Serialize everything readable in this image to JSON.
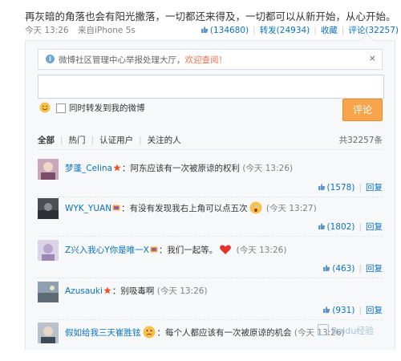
{
  "post": {
    "text": "再灰暗的角落也会有阳光撒落，一切都还来得及，一切都可以从新开始，从心开始。",
    "time": "今天 13:26",
    "source": "来自iPhone 5s",
    "likes": "(134680)",
    "repost": "转发(24934)",
    "favorite": "收藏",
    "comment": "评论(32257)"
  },
  "notice": {
    "text": "微博社区管理中心举报处理大厅，",
    "link": "欢迎查阅！",
    "close": "×"
  },
  "composer": {
    "checkbox_label": "同时转发到我的微博",
    "submit": "评论"
  },
  "tabs": {
    "all": "全部",
    "hot": "热门",
    "verified": "认证用户",
    "following": "关注的人",
    "count": "共32257条"
  },
  "comments": [
    {
      "user": "梦蓬_Celina",
      "text": "：阿东应该有一次被原谅的权利",
      "time": "(今天 13:26)",
      "likes": "(1578)",
      "reply": "回复"
    },
    {
      "user": "WYK_YUAN",
      "text": "：有没有发现我右上角可以点五次",
      "time": "(今天 13:27)",
      "likes": "(1802)",
      "reply": "回复"
    },
    {
      "user": "Z兴入我心Y你是唯一X",
      "text": "：我们一起等。",
      "time": "(今天 13:26)",
      "likes": "(463)",
      "reply": "回复"
    },
    {
      "user": "Azusauki",
      "text": "：别吸毒啊",
      "time": "(今天 13:26)",
      "likes": "(931)",
      "reply": "回复"
    },
    {
      "user": "假如给我三天崔胜铉",
      "text": "：每个人都应该有一次被原谅的机会",
      "time": "(今天 13:26)",
      "likes": "",
      "reply": ""
    }
  ],
  "watermark": "Baidu经验",
  "colors": {
    "link": "#0a72c1",
    "accent": "#f7a44a",
    "notice_link": "#eb7350"
  }
}
